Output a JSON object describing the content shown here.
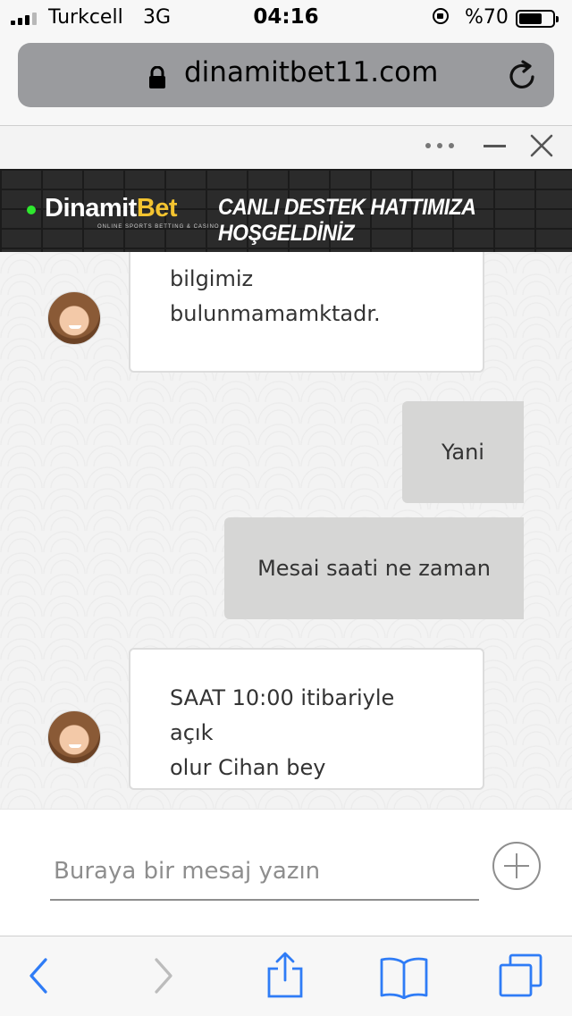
{
  "status_bar": {
    "carrier": "Turkcell",
    "network": "3G",
    "time": "04:16",
    "battery": "%70",
    "battery_level": 0.7,
    "signal_bars": 4,
    "signal_bars_active": 3
  },
  "browser": {
    "url": "dinamitbet11.com",
    "icons": [
      "lock-icon",
      "reload-icon"
    ]
  },
  "chat_header": {
    "icons": [
      "more-dots-icon",
      "minimize-icon",
      "close-icon"
    ]
  },
  "banner": {
    "brand_part1": "Dinamit",
    "brand_part2": "Bet",
    "tagline": "ONLINE SPORTS BETTING & CASINO",
    "welcome": "CANLI DESTEK HATTIMIZA HOŞGELDİNİZ",
    "brand_color": "#f3c330"
  },
  "messages": [
    {
      "from": "agent",
      "text_lines": [
        "bilgimiz",
        "bulunmamamktadr."
      ]
    },
    {
      "from": "user",
      "text": "Yani"
    },
    {
      "from": "user",
      "text": "Mesai saati ne zaman"
    },
    {
      "from": "agent",
      "text_lines": [
        "SAAT 10:00 itibariyle açık",
        "olur Cihan bey"
      ]
    }
  ],
  "composer": {
    "placeholder": "Buraya bir mesaj yazın",
    "value": ""
  },
  "toolbar": {
    "icons": [
      "back-icon",
      "forward-icon",
      "share-icon",
      "bookmarks-icon",
      "tabs-icon"
    ],
    "accent": "#2f7cf6"
  }
}
